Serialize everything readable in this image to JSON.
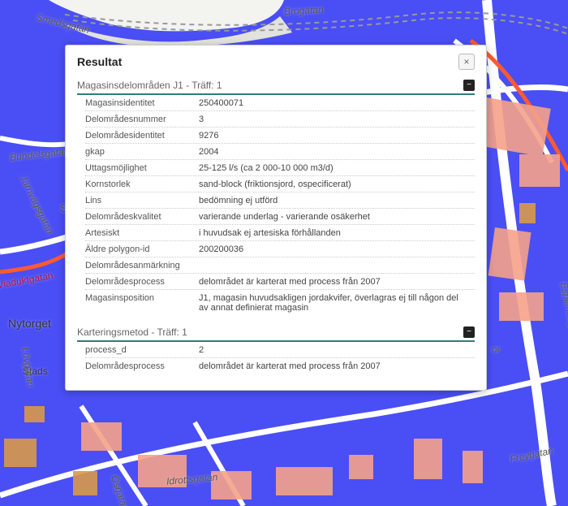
{
  "dialog": {
    "title": "Resultat",
    "close_label": "×"
  },
  "sections": [
    {
      "title": "Magasinsdelområden J1 - Träff: 1",
      "collapse_glyph": "−",
      "rows": [
        {
          "label": "Magasinsidentitet",
          "value": "250400071"
        },
        {
          "label": "Delområdesnummer",
          "value": "3"
        },
        {
          "label": "Delområdesidentitet",
          "value": "9276"
        },
        {
          "label": "gkap",
          "value": "2004"
        },
        {
          "label": "Uttagsmöjlighet",
          "value": "25-125 l/s (ca 2 000-10 000 m3/d)"
        },
        {
          "label": "Kornstorlek",
          "value": "sand-block (friktionsjord, ospecificerat)"
        },
        {
          "label": "Lins",
          "value": "bedömning ej utförd"
        },
        {
          "label": "Delområdeskvalitet",
          "value": "varierande underlag - varierande osäkerhet"
        },
        {
          "label": "Artesiskt",
          "value": "i huvudsak ej artesiska förhållanden"
        },
        {
          "label": "Äldre polygon-id",
          "value": "200200036"
        },
        {
          "label": "Delområdesanmärkning",
          "value": ""
        },
        {
          "label": "Delområdesprocess",
          "value": "delområdet är karterat med process från 2007"
        },
        {
          "label": "Magasinsposition",
          "value": "J1, magasin huvudsakligen jordakvifer, överlagras ej till någon del av annat definierat magasin"
        }
      ]
    },
    {
      "title": "Karteringsmetod - Träff: 1",
      "collapse_glyph": "−",
      "rows": [
        {
          "label": "process_d",
          "value": "2"
        },
        {
          "label": "Delområdesprocess",
          "value": "delområdet är karterat med process från 2007"
        }
      ]
    }
  ],
  "map_labels": {
    "brogatan": "Brogatan",
    "smedsgatan": "Smedsgatan",
    "bundelsgatan": "Bundelsgatan",
    "jarnvagsgatan": "Järnvägsgatan",
    "viaduktgatan": "Viaduktgatan",
    "nytorget": "Nytorget",
    "stads": "Stads",
    "lovagatan": "Lövgatan",
    "idrottsgatan": "Idrottsgatan",
    "osgatan": "Ösgatan",
    "freygatan": "Freygatan",
    "esplanadergatan": "Esplanadgatan",
    "s_letter": "S",
    "or": "or"
  }
}
